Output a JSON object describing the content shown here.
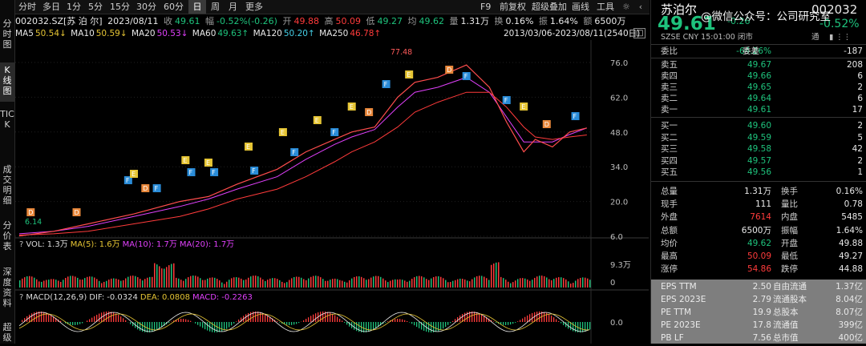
{
  "left_tabs": [
    {
      "label": "分时图",
      "active": false
    },
    {
      "label": "K线图",
      "active": true
    },
    {
      "label": "TICK",
      "active": false
    },
    {
      "label": "成交明细",
      "active": false
    },
    {
      "label": "分价表",
      "active": false
    },
    {
      "label": "深度资料",
      "active": false
    },
    {
      "label": "超级",
      "active": false
    }
  ],
  "toolbar": {
    "periods": [
      "分时",
      "多日",
      "1分",
      "5分",
      "15分",
      "30分",
      "60分",
      "日",
      "周",
      "月",
      "更多"
    ],
    "active_period": "日",
    "right": [
      "F9",
      "前复权",
      "超级叠加",
      "画线",
      "工具"
    ],
    "icons": [
      "settings-icon",
      "chevron-left-icon"
    ]
  },
  "quote": {
    "code_name": "002032.SZ[苏 泊 尔]",
    "date": "2023/08/11",
    "close_label": "收",
    "close": "49.61",
    "chg_label": "幅",
    "chg": "-0.52%(-0.26)",
    "open_label": "开",
    "open": "49.88",
    "high_label": "高",
    "high": "50.09",
    "low_label": "低",
    "low": "49.27",
    "avg_label": "均",
    "avg": "49.62",
    "vol_label": "量",
    "vol": "1.31万",
    "turn_label": "换",
    "turn": "0.16%",
    "amp_label": "振",
    "amp": "1.64%",
    "amt_label": "额",
    "amt": "6500万"
  },
  "ma_line": {
    "ma5": "MA5",
    "ma5v": "50.54↓",
    "ma10": "MA10",
    "ma10v": "50.59↓",
    "ma20": "MA20",
    "ma20v": "50.53↓",
    "ma60": "MA60",
    "ma60v": "49.63↑",
    "ma120": "MA120",
    "ma120v": "50.20↑",
    "ma250": "MA250",
    "ma250v": "46.78↑",
    "range": "2013/03/06-2023/08/11(2540日)"
  },
  "chart_data": {
    "type": "line",
    "x_range": [
      "2013/03/06",
      "2023/08/11"
    ],
    "ylim": [
      6.0,
      76.0
    ],
    "y_ticks": [
      "76.0",
      "62.0",
      "48.0",
      "34.0",
      "20.0",
      "6.0"
    ],
    "price_labels": {
      "high": "77.48",
      "low": "6.14"
    },
    "price_x": [
      0,
      0.06,
      0.12,
      0.2,
      0.28,
      0.33,
      0.38,
      0.45,
      0.5,
      0.55,
      0.58,
      0.62,
      0.66,
      0.69,
      0.73,
      0.78,
      0.82,
      0.85,
      0.88,
      0.9,
      0.93,
      0.96,
      0.99
    ],
    "price_y": [
      6.1,
      8,
      11,
      15,
      20,
      22,
      27,
      33,
      40,
      45,
      48,
      50,
      62,
      68,
      70,
      75,
      66,
      52,
      40,
      45,
      42,
      48,
      49.6
    ],
    "ma_series": [
      {
        "name": "MA60",
        "values_y": [
          7,
          8,
          10,
          14,
          18,
          21,
          25,
          30,
          37,
          43,
          46,
          49,
          58,
          64,
          66,
          70,
          64,
          54,
          44,
          44,
          44,
          47,
          49.6
        ],
        "color": "#e040fb"
      },
      {
        "name": "MA250",
        "values_y": [
          6.5,
          7,
          8,
          11,
          14,
          17,
          21,
          25,
          30,
          36,
          40,
          44,
          50,
          56,
          60,
          64,
          64,
          58,
          50,
          46,
          45,
          46,
          46.8
        ],
        "color": "#ff3b3b"
      }
    ],
    "vol_panel": {
      "label": "VOL:",
      "vol": "1.3万",
      "ma5_label": "MA(5):",
      "ma5": "1.6万",
      "ma10_label": "MA(10):",
      "ma10": "1.7万",
      "ma20_label": "MA(20):",
      "ma20": "1.7万",
      "y_ticks": [
        "9.3万",
        "0"
      ],
      "ylim": [
        0,
        9.3
      ]
    },
    "macd_panel": {
      "label": "MACD(12,26,9)",
      "dif_label": "DIF:",
      "dif": "-0.0324",
      "dea_label": "DEA:",
      "dea": "0.0808",
      "macd_label": "MACD:",
      "macd": "-0.2263",
      "y_ticks": [
        "0.0"
      ]
    },
    "q_mark": "?"
  },
  "right_panel": {
    "name": "苏泊尔",
    "code": "002032",
    "price": "49.61",
    "chg": "-0.26",
    "pct": "-0.52%",
    "tags": "SZSE  CNY  15:01:00  闭市",
    "tags2": "通",
    "watermark": "@微信公众号：公司研究室",
    "weibi_label": "委比",
    "weibi": "-64.26%",
    "weicha_label": "委差",
    "weicha": "-187",
    "asks": [
      {
        "label": "卖五",
        "price": "49.67",
        "vol": "208"
      },
      {
        "label": "卖四",
        "price": "49.66",
        "vol": "6"
      },
      {
        "label": "卖三",
        "price": "49.65",
        "vol": "2"
      },
      {
        "label": "卖二",
        "price": "49.64",
        "vol": "6"
      },
      {
        "label": "卖一",
        "price": "49.61",
        "vol": "17"
      }
    ],
    "bids": [
      {
        "label": "买一",
        "price": "49.60",
        "vol": "2"
      },
      {
        "label": "买二",
        "price": "49.59",
        "vol": "5"
      },
      {
        "label": "买三",
        "price": "49.58",
        "vol": "42"
      },
      {
        "label": "买四",
        "price": "49.57",
        "vol": "2"
      },
      {
        "label": "买五",
        "price": "49.56",
        "vol": "1"
      }
    ],
    "stats": [
      [
        {
          "l": "总量",
          "v": "1.31万",
          "c": "white"
        },
        {
          "l": "换手",
          "v": "0.16%",
          "c": "white"
        }
      ],
      [
        {
          "l": "现手",
          "v": "111",
          "c": "white"
        },
        {
          "l": "量比",
          "v": "0.78",
          "c": "white"
        }
      ],
      [
        {
          "l": "外盘",
          "v": "7614",
          "c": "red"
        },
        {
          "l": "内盘",
          "v": "5485",
          "c": "green"
        }
      ],
      [
        {
          "l": "总额",
          "v": "6500万",
          "c": "white"
        },
        {
          "l": "振幅",
          "v": "1.64%",
          "c": "white"
        }
      ],
      [
        {
          "l": "均价",
          "v": "49.62",
          "c": "green"
        },
        {
          "l": "开盘",
          "v": "49.88",
          "c": "red"
        }
      ],
      [
        {
          "l": "最高",
          "v": "50.09",
          "c": "red"
        },
        {
          "l": "最低",
          "v": "49.27",
          "c": "green"
        }
      ],
      [
        {
          "l": "涨停",
          "v": "54.86",
          "c": "red"
        },
        {
          "l": "跌停",
          "v": "44.88",
          "c": "green"
        }
      ]
    ],
    "fundamentals": [
      [
        {
          "l": "EPS TTM",
          "v": "2.50"
        },
        {
          "l": "自由流通",
          "v": "1.37亿"
        }
      ],
      [
        {
          "l": "EPS 2023E",
          "v": "2.79"
        },
        {
          "l": "流通股本",
          "v": "8.04亿"
        }
      ],
      [
        {
          "l": "PE TTM",
          "v": "19.9"
        },
        {
          "l": "总股本",
          "v": "8.07亿"
        }
      ],
      [
        {
          "l": "PE 2023E",
          "v": "17.8"
        },
        {
          "l": "流通值",
          "v": "399亿"
        }
      ],
      [
        {
          "l": "PB LF",
          "v": "7.56"
        },
        {
          "l": "总市值",
          "v": "400亿"
        }
      ]
    ]
  }
}
